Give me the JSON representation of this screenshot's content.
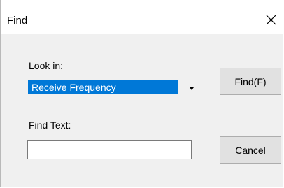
{
  "dialog": {
    "title": "Find",
    "close_icon": "close-icon"
  },
  "look_in": {
    "label": "Look in:",
    "selected": "Receive Frequency",
    "dropdown_icon": "dropdown-arrow-icon"
  },
  "find_text": {
    "label": "Find Text:",
    "value": ""
  },
  "buttons": {
    "find": "Find(F)",
    "cancel": "Cancel"
  },
  "colors": {
    "selection": "#0078d7",
    "dialog_bg": "#f0f0f0",
    "button_bg": "#e1e1e1"
  }
}
